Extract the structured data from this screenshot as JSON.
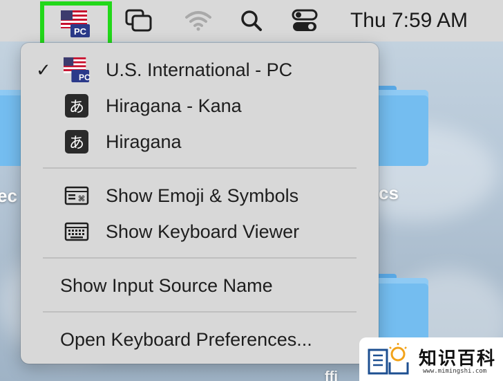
{
  "menubar": {
    "input_source": "U.S. International - PC",
    "clock": "Thu 7:59 AM",
    "icons": [
      "us-flag-pc-icon",
      "window-switcher-icon",
      "wifi-icon",
      "search-icon",
      "control-center-icon"
    ],
    "highlight_color": "#22d81a"
  },
  "menu": {
    "sources": [
      {
        "label": "U.S. International - PC",
        "icon": "us-flag-pc-icon",
        "checked": true
      },
      {
        "label": "Hiragana - Kana",
        "icon": "hiragana-icon",
        "checked": false
      },
      {
        "label": "Hiragana",
        "icon": "hiragana-icon",
        "checked": false
      }
    ],
    "checkmark": "✓",
    "kana_glyph": "あ",
    "flag_badge": "PC",
    "tools": [
      {
        "label": "Show Emoji & Symbols",
        "icon": "emoji-symbols-icon"
      },
      {
        "label": "Show Keyboard Viewer",
        "icon": "keyboard-viewer-icon"
      }
    ],
    "show_input_source_name": "Show Input Source Name",
    "open_preferences": "Open Keyboard Preferences..."
  },
  "desktop": {
    "label_left": "ec",
    "label_right": "cs",
    "label_bottom": "ffi"
  },
  "watermark": {
    "title": "知识百科",
    "url": "www.mimingshi.com"
  }
}
